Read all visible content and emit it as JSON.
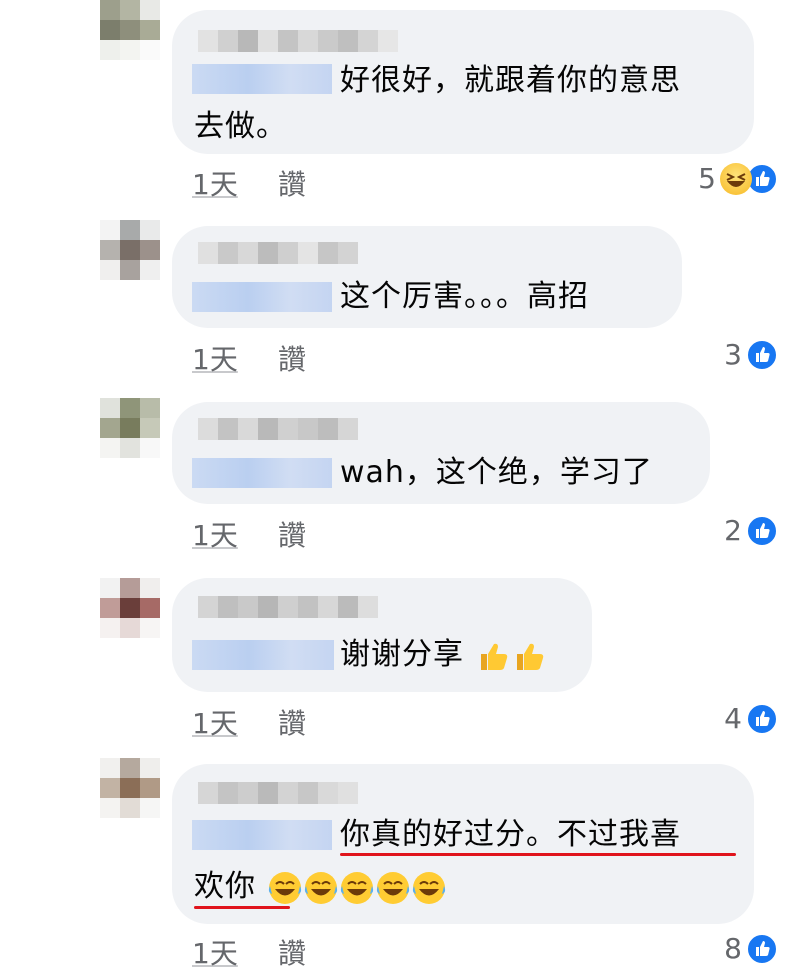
{
  "comments": [
    {
      "text_line1": "好很好，就跟着你的意思",
      "text_line2": "去做。",
      "time": "1天",
      "like": "讚",
      "count": "5",
      "reactions": [
        "haha-icon",
        "like-icon"
      ]
    },
    {
      "text_line1": "这个厉害。。。高招",
      "time": "1天",
      "like": "讚",
      "count": "3",
      "reactions": [
        "like-icon"
      ]
    },
    {
      "text_line1": "wah，这个绝，学习了",
      "time": "1天",
      "like": "讚",
      "count": "2",
      "reactions": [
        "like-icon"
      ]
    },
    {
      "text_line1": "谢谢分享",
      "emoji": [
        "thumbs-up-icon",
        "thumbs-up-icon"
      ],
      "time": "1天",
      "like": "讚",
      "count": "4",
      "reactions": [
        "like-icon"
      ]
    },
    {
      "text_line1": "你真的好过分。不过我喜",
      "text_line2": "欢你",
      "emoji": [
        "tears-of-joy-icon",
        "tears-of-joy-icon",
        "tears-of-joy-icon",
        "tears-of-joy-icon",
        "tears-of-joy-icon"
      ],
      "time": "1天",
      "like": "讚",
      "count": "8",
      "reactions": [
        "like-icon"
      ]
    }
  ],
  "colors": {
    "bubble": "#f0f2f5",
    "like_blue": "#1877f2",
    "meta_gray": "#65676b",
    "annotation_red": "#e0141c"
  }
}
